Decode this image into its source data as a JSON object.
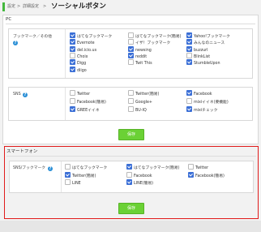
{
  "breadcrumb": {
    "items": [
      "設定",
      "詳細設定"
    ],
    "separator": ">",
    "current": "ソーシャルボタン"
  },
  "pc": {
    "section_label": "PC",
    "bookmark_row": {
      "label": "ブックマーク／その他",
      "options": [
        {
          "label": "はてなブックマーク",
          "checked": true
        },
        {
          "label": "はてなブックマーク(簡易)",
          "checked": false
        },
        {
          "label": "Yahoo!ブックマーク",
          "checked": true
        },
        {
          "label": "Evernote",
          "checked": true
        },
        {
          "label": "イザ！ブックマーク",
          "checked": false
        },
        {
          "label": "みんなのニュース",
          "checked": true
        },
        {
          "label": "del.icio.us",
          "checked": true
        },
        {
          "label": "newsing",
          "checked": true
        },
        {
          "label": "buzzurl",
          "checked": true
        },
        {
          "label": "Choix",
          "checked": false
        },
        {
          "label": "reddit",
          "checked": true
        },
        {
          "label": "BlinkList",
          "checked": false
        },
        {
          "label": "Digg",
          "checked": true
        },
        {
          "label": "Twit This",
          "checked": false
        },
        {
          "label": "StumbleUpon",
          "checked": true
        },
        {
          "label": "diigo",
          "checked": true
        }
      ]
    },
    "sns_row": {
      "label": "SNS",
      "options": [
        {
          "label": "Twitter",
          "checked": false
        },
        {
          "label": "Twitter(簡易)",
          "checked": false
        },
        {
          "label": "Facebook",
          "checked": true
        },
        {
          "label": "Facebook(簡易)",
          "checked": false
        },
        {
          "label": "Google+",
          "checked": false
        },
        {
          "label": "mixiイイネ(要機能)",
          "checked": false
        },
        {
          "label": "GREEイイネ",
          "checked": true
        },
        {
          "label": "BU-IQ",
          "checked": false
        },
        {
          "label": "mixiチェック",
          "checked": true
        }
      ]
    },
    "save_label": "保存"
  },
  "smartphone": {
    "section_label": "スマートフォン",
    "sns_row": {
      "label": "SNS/ブックマーク",
      "options": [
        {
          "label": "はてなブックマーク",
          "checked": false
        },
        {
          "label": "はてなブックマーク(簡易)",
          "checked": true
        },
        {
          "label": "Twitter",
          "checked": false
        },
        {
          "label": "Twitter(簡易)",
          "checked": true
        },
        {
          "label": "Facebook",
          "checked": false
        },
        {
          "label": "Facebook(簡易)",
          "checked": true
        },
        {
          "label": "LINE",
          "checked": false
        },
        {
          "label": "LINE(簡易)",
          "checked": true
        }
      ]
    },
    "save_label": "保存"
  },
  "colors": {
    "accent_green": "#6bd135",
    "highlight_red": "#e11b1b",
    "check_blue": "#3b6fd6",
    "help_blue": "#2a8fd6"
  }
}
